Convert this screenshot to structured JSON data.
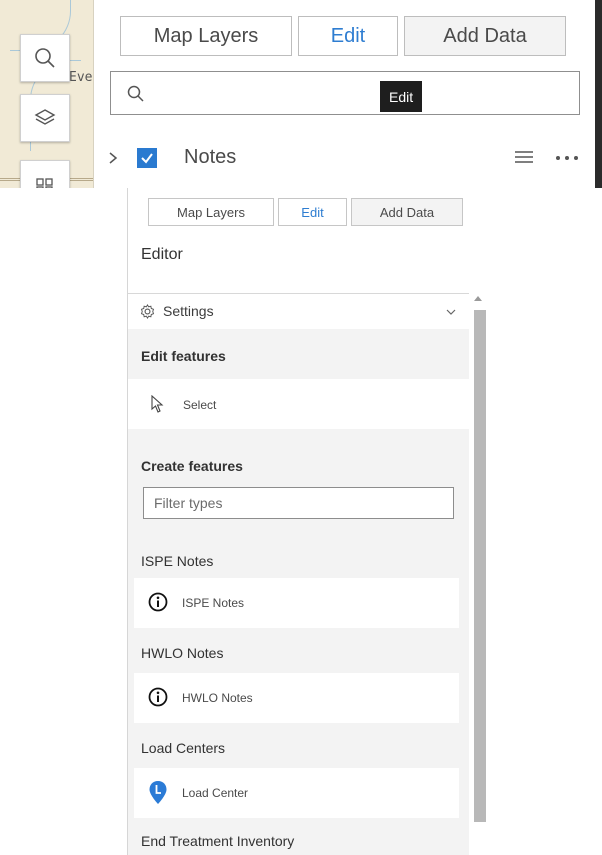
{
  "top": {
    "map_label": "Eve",
    "tabs": [
      {
        "label": "Map Layers",
        "active": false
      },
      {
        "label": "Edit",
        "active": true
      },
      {
        "label": "Add Data",
        "active": false
      }
    ],
    "search_placeholder": "",
    "tooltip": "Edit",
    "layer": {
      "name": "Notes",
      "checked": true
    }
  },
  "editor": {
    "tabs": [
      {
        "label": "Map Layers",
        "active": false
      },
      {
        "label": "Edit",
        "active": true
      },
      {
        "label": "Add Data",
        "active": false
      }
    ],
    "title": "Editor",
    "settings_label": "Settings",
    "edit_features": {
      "title": "Edit features",
      "select_label": "Select"
    },
    "create_features": {
      "title": "Create features",
      "filter_placeholder": "Filter types",
      "groups": [
        {
          "title": "ISPE Notes",
          "item": "ISPE Notes",
          "icon": "info-icon"
        },
        {
          "title": "HWLO Notes",
          "item": "HWLO Notes",
          "icon": "info-icon"
        },
        {
          "title": "Load Centers",
          "item": "Load Center",
          "icon": "map-pin-icon"
        },
        {
          "title": "End Treatment Inventory"
        }
      ]
    }
  },
  "colors": {
    "accent": "#2e7dd1",
    "tooltip_bg": "#1e1e1e",
    "scroll_bg": "#f3f3f3",
    "map_bg": "#f1ead6",
    "pin": "#2b7bd6"
  }
}
